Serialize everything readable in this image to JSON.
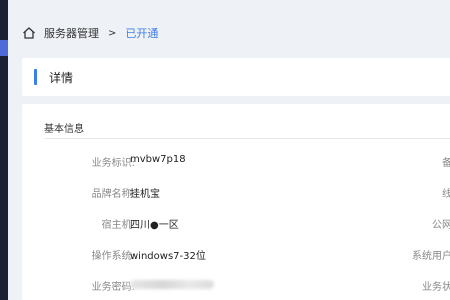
{
  "breadcrumb": {
    "root": "服务器管理",
    "separator": ">",
    "current": "已开通"
  },
  "detail": {
    "title": "详情"
  },
  "basic_info": {
    "section_title": "基本信息",
    "rows": [
      {
        "label": "业务标识:",
        "value": "mvbw7p18",
        "right_label": "备"
      },
      {
        "label": "品牌名称:",
        "value": "挂机宝",
        "right_label": "线"
      },
      {
        "label": "宿主机:",
        "value": "四川●一区",
        "right_label": "公网"
      },
      {
        "label": "操作系统:",
        "value": "windows7-32位",
        "right_label": "系统用户"
      },
      {
        "label": "业务密码:",
        "value": "",
        "right_label": "业务状"
      }
    ]
  },
  "colors": {
    "accent": "#3c7fe8",
    "sidebar": "#1c2233",
    "background": "#eef1f6"
  }
}
